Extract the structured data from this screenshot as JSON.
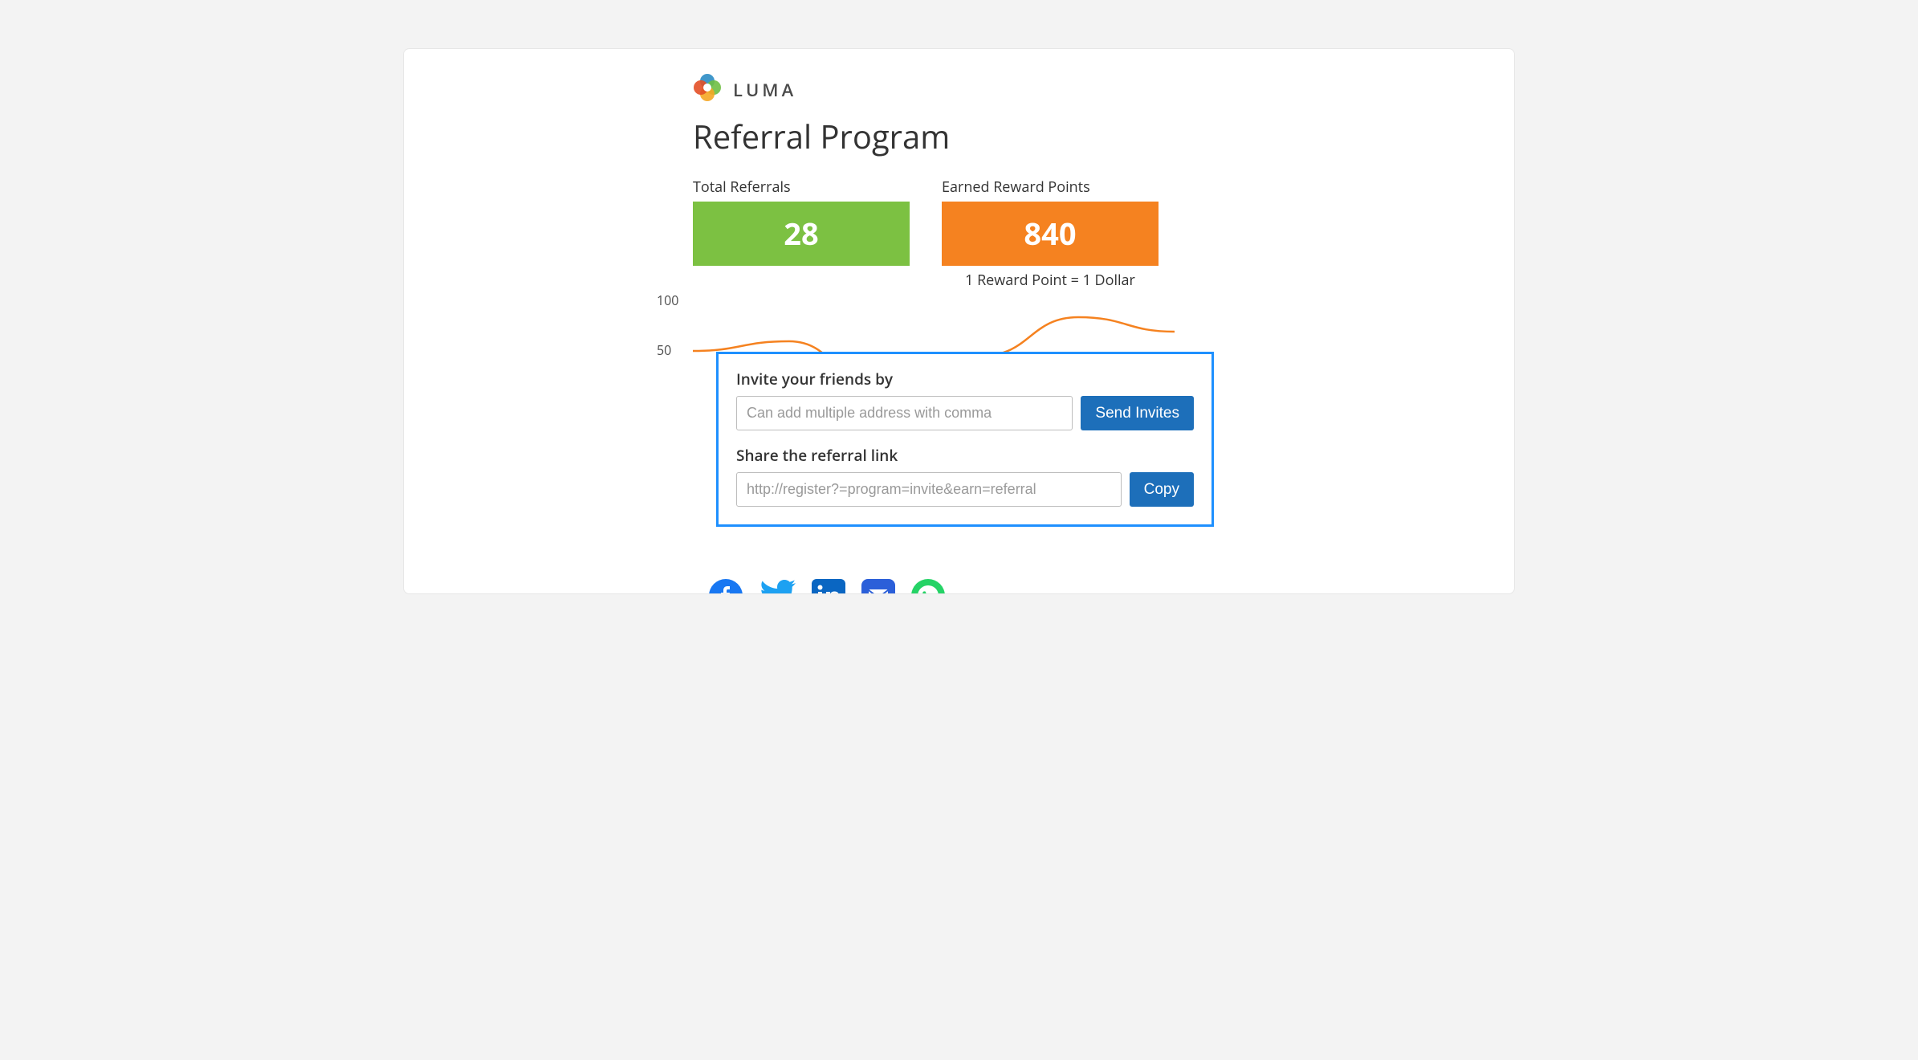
{
  "brand": "LUMA",
  "page_title": "Referral Program",
  "stats": {
    "referrals_label": "Total Referrals",
    "referrals_value": "28",
    "points_label": "Earned Reward Points",
    "points_value": "840",
    "points_note": "1 Reward Point = 1 Dollar"
  },
  "chart_data": {
    "type": "line",
    "title": "",
    "xlabel": "",
    "ylabel": "",
    "ylim": [
      0,
      100
    ],
    "yticks": [
      50,
      100
    ],
    "x": [
      0,
      1,
      2,
      3,
      4,
      5
    ],
    "values": [
      45,
      55,
      0,
      40,
      80,
      65
    ],
    "series_color": "#f58220"
  },
  "yticks": {
    "t100": "100",
    "t50": "50"
  },
  "invite": {
    "label": "Invite your friends by",
    "placeholder": "Can add multiple address with comma",
    "button": "Send Invites"
  },
  "share": {
    "label": "Share the referral link",
    "url": "http://register?=program=invite&earn=referral",
    "button": "Copy"
  },
  "social": [
    "facebook",
    "twitter",
    "linkedin",
    "email",
    "whatsapp"
  ]
}
